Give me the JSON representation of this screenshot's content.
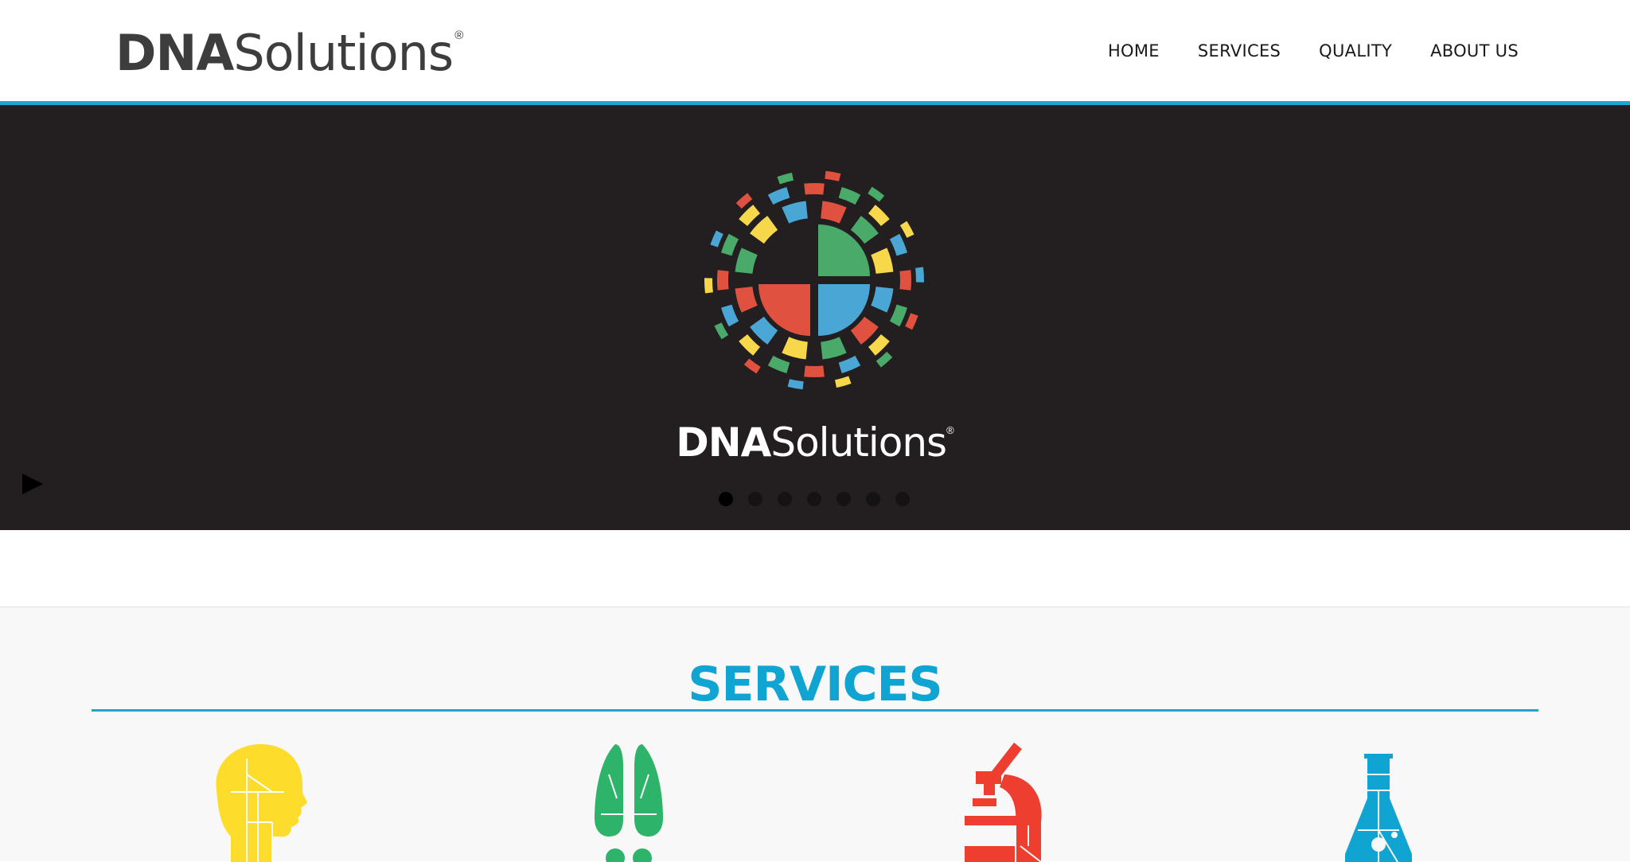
{
  "header": {
    "brand_bold": "DNA",
    "brand_light": "Solutions",
    "brand_reg": "®",
    "nav": [
      {
        "label": "HOME"
      },
      {
        "label": "SERVICES"
      },
      {
        "label": "QUALITY"
      },
      {
        "label": "ABOUT US"
      }
    ],
    "accent_color": "#1da6cf"
  },
  "hero": {
    "background": "#231f20",
    "brand_bold": "DNA",
    "brand_light": "Solutions",
    "brand_reg": "®",
    "slide_count": 7,
    "active_slide": 1,
    "logo_colors": [
      "#4aaa6a",
      "#e05140",
      "#4aa6d4",
      "#f6d84a"
    ]
  },
  "services": {
    "title": "SERVICES",
    "title_color": "#10a4d2",
    "icons": [
      {
        "name": "head-icon",
        "color": "#fddc2c"
      },
      {
        "name": "lungs-icon",
        "color": "#2db36a"
      },
      {
        "name": "microscope-icon",
        "color": "#ee3e30"
      },
      {
        "name": "flask-icon",
        "color": "#10a4d2"
      }
    ]
  }
}
